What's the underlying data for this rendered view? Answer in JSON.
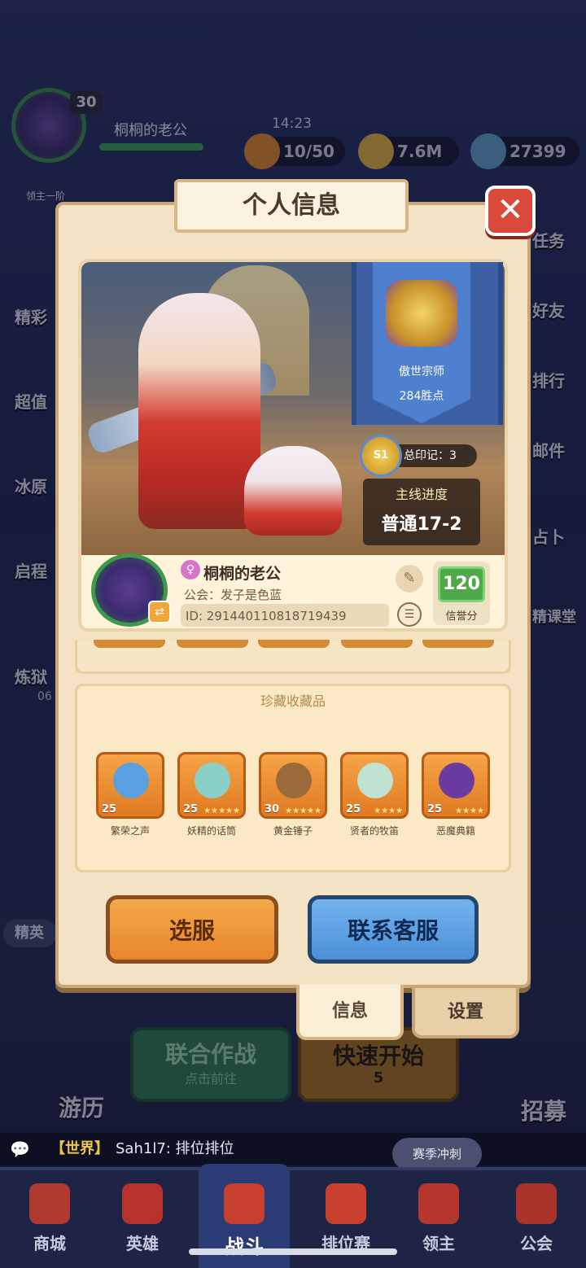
{
  "hud": {
    "level": "30",
    "player_name": "桐桐的老公",
    "rank_under_avatar": "领主一阶",
    "time": "14:23",
    "stamina": "10/50",
    "gold": "7.6M",
    "gems": "27399"
  },
  "side_menu": {
    "left": [
      "精彩",
      "超值",
      "冰原",
      "启程",
      "炼狱",
      "精英"
    ],
    "left_timer": "06",
    "right": [
      "任务",
      "好友",
      "排行",
      "邮件",
      "占卜",
      "精课堂"
    ]
  },
  "dialog": {
    "title": "个人信息",
    "close_icon": "close-icon",
    "rank": {
      "name": "傲世宗师",
      "points": "284胜点"
    },
    "seal": {
      "badge": "S1",
      "label": "总印记：3"
    },
    "progress": {
      "title": "主线进度",
      "value": "普通17-2"
    },
    "profile": {
      "name": "桐桐的老公",
      "guild": "公会：发子是色蓝",
      "id": "ID: 291440110818719439",
      "credit_value": "120",
      "credit_label": "信誉分"
    },
    "collection": {
      "title": "珍藏收藏品",
      "items": [
        {
          "name": "繁荣之声",
          "level": "25",
          "stars": "",
          "color": "#5aa0e0"
        },
        {
          "name": "妖精的话筒",
          "level": "25",
          "stars": "★★★★★",
          "color": "#8ad0c8"
        },
        {
          "name": "黄金锤子",
          "level": "30",
          "stars": "★★★★★",
          "color": "#9a6a3a"
        },
        {
          "name": "贤者的牧笛",
          "level": "25",
          "stars": "★★★★",
          "color": "#bfe3d0"
        },
        {
          "name": "恶魔典籍",
          "level": "25",
          "stars": "★★★★",
          "color": "#6a3aa0"
        }
      ]
    },
    "buttons": {
      "select_server": "选服",
      "contact_service": "联系客服"
    },
    "tabs": {
      "info": "信息",
      "settings": "设置"
    }
  },
  "lobby": {
    "travel": "游历",
    "recruit": "招募",
    "coop_title": "联合作战",
    "coop_sub": "点击前往",
    "quick_title": "快速开始",
    "quick_sub": "5"
  },
  "chat": {
    "channel": "【世界】",
    "message": "Sah1l7: 排位排位",
    "season_button": "赛季冲刺"
  },
  "nav": {
    "items": [
      "商城",
      "英雄",
      "战斗",
      "排位赛",
      "领主",
      "公会"
    ],
    "active": "战斗"
  },
  "colors": {
    "dialog_bg": "#f3e2c3",
    "accent_orange": "#e8862b",
    "accent_blue": "#4c8fd7",
    "close_red": "#d94a3a",
    "credit_green": "#4fa84a"
  }
}
